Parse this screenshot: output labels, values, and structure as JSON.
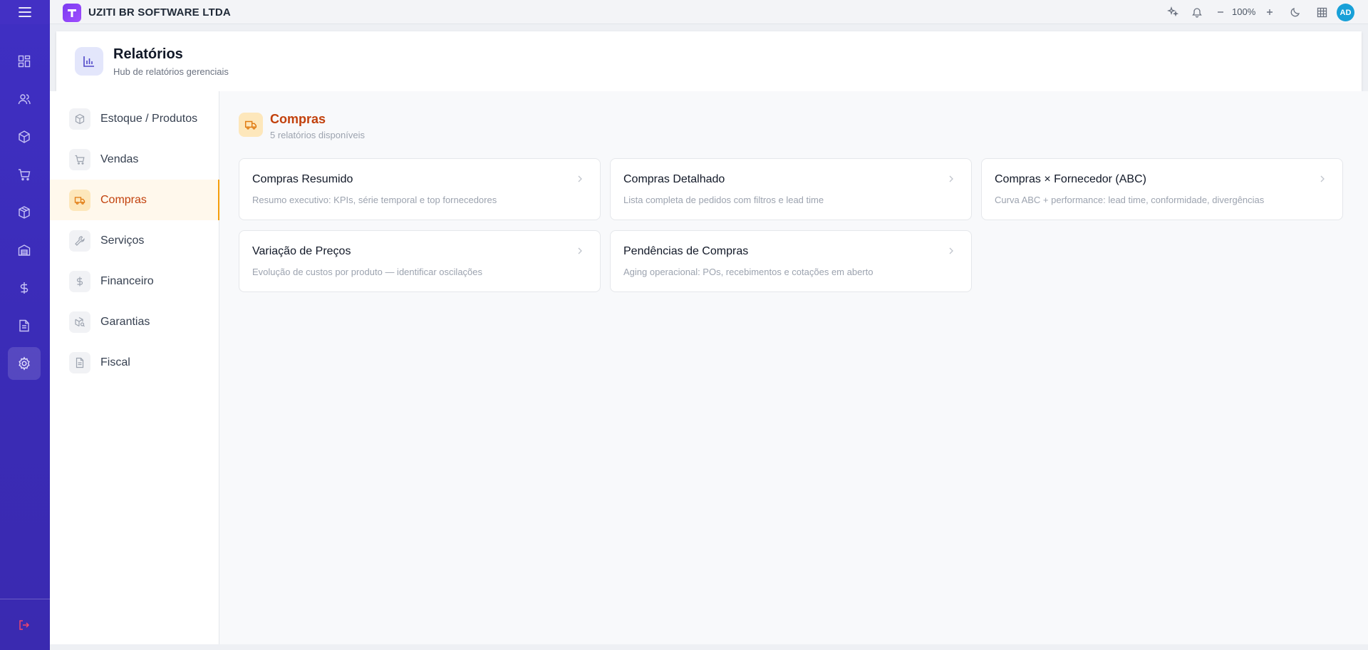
{
  "topbar": {
    "company": "UZITI BR SOFTWARE LTDA",
    "zoom": "100%",
    "avatar_initials": "AD",
    "icons": [
      "sparkles-icon",
      "bell-icon",
      "minus-icon",
      "plus-icon",
      "moon-icon",
      "grid-icon"
    ]
  },
  "rail": {
    "items": [
      "dashboard-icon",
      "users-icon",
      "box-icon",
      "cart-icon",
      "packages-icon",
      "warehouse-icon",
      "dollar-icon",
      "document-icon",
      "gear-icon"
    ],
    "active": "gear-icon",
    "footer": "logout-icon"
  },
  "header": {
    "title": "Relatórios",
    "subtitle": "Hub de relatórios gerenciais"
  },
  "sidenav": {
    "items": [
      {
        "label": "Estoque / Produtos",
        "icon": "box-icon"
      },
      {
        "label": "Vendas",
        "icon": "cart-icon"
      },
      {
        "label": "Compras",
        "icon": "truck-icon",
        "active": true
      },
      {
        "label": "Serviços",
        "icon": "wrench-icon"
      },
      {
        "label": "Financeiro",
        "icon": "dollar-icon"
      },
      {
        "label": "Garantias",
        "icon": "box-search-icon"
      },
      {
        "label": "Fiscal",
        "icon": "document-icon"
      }
    ]
  },
  "section": {
    "title": "Compras",
    "subtitle": "5 relatórios disponíveis",
    "cards": [
      {
        "title": "Compras Resumido",
        "description": "Resumo executivo: KPIs, série temporal e top fornecedores"
      },
      {
        "title": "Compras Detalhado",
        "description": "Lista completa de pedidos com filtros e lead time"
      },
      {
        "title": "Compras × Fornecedor (ABC)",
        "description": "Curva ABC + performance: lead time, conformidade, divergências"
      },
      {
        "title": "Variação de Preços",
        "description": "Evolução de custos por produto — identificar oscilações"
      },
      {
        "title": "Pendências de Compras",
        "description": "Aging operacional: POs, recebimentos e cotações em aberto"
      }
    ]
  },
  "colors": {
    "rail": "#3f2fc2",
    "accent": "#c2410c",
    "accent_bg": "#fde7bb",
    "header_icon_bg": "#e3e6fb"
  }
}
